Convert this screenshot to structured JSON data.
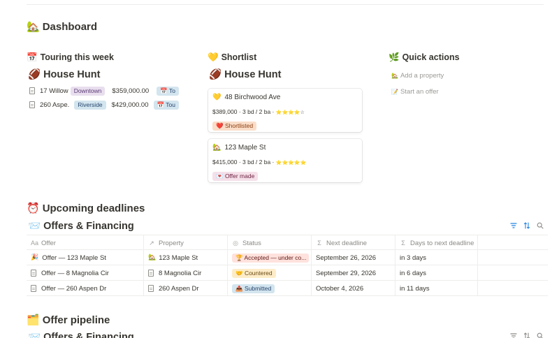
{
  "page": {
    "title": "Dashboard",
    "title_icon": "🏡"
  },
  "touring": {
    "heading": "Touring this week",
    "heading_icon": "📅",
    "db_title": "House Hunt",
    "db_icon": "🏈",
    "rows": [
      {
        "name": "17 Willow ...",
        "neighborhood": "Downtown",
        "price": "$359,000.00",
        "date_tag": "📅 To"
      },
      {
        "name": "260 Aspe...",
        "neighborhood": "Riverside",
        "price": "$429,000.00",
        "date_tag": "📅 Tou"
      }
    ]
  },
  "shortlist": {
    "heading": "Shortlist",
    "heading_icon": "💛",
    "db_title": "House Hunt",
    "db_icon": "🏈",
    "cards": [
      {
        "icon": "💛",
        "title": "48 Birchwood Ave",
        "meta": "$389,000 · 3 bd / 2 ba · ",
        "stars": "⭐⭐⭐⭐☆",
        "status": "❤️ Shortlisted"
      },
      {
        "icon": "🏡",
        "title": "123 Maple St",
        "meta": "$415,000 · 3 bd / 2 ba · ",
        "stars": "⭐⭐⭐⭐⭐",
        "status": "💌 Offer made"
      }
    ]
  },
  "quick_actions": {
    "heading": "Quick actions",
    "heading_icon": "🌿",
    "items": [
      {
        "icon": "🏡",
        "label": "Add a property"
      },
      {
        "icon": "📝",
        "label": "Start an offer"
      }
    ]
  },
  "deadlines": {
    "heading": "Upcoming deadlines",
    "heading_icon": "⏰",
    "db_title": "Offers & Financing",
    "db_icon": "📨",
    "columns": [
      "Offer",
      "Property",
      "Status",
      "Next deadline",
      "Days to next deadline"
    ],
    "column_icons": [
      "Aa",
      "↗",
      "◎",
      "Σ",
      "Σ"
    ],
    "rows": [
      {
        "offer_icon": "🎉",
        "offer": "Offer — 123 Maple St",
        "property_icon": "🏡",
        "property": "123 Maple St",
        "status": "🏆 Accepted — under co...",
        "deadline": "September 26, 2026",
        "days": "in 3 days"
      },
      {
        "offer_icon": "doc",
        "offer": "Offer — 8 Magnolia Cir",
        "property_icon": "doc",
        "property": "8 Magnolia Cir",
        "status": "🤝 Countered",
        "deadline": "September 29, 2026",
        "days": "in 6 days"
      },
      {
        "offer_icon": "doc",
        "offer": "Offer — 260 Aspen Dr",
        "property_icon": "doc",
        "property": "260 Aspen Dr",
        "status": "📤 Submitted",
        "deadline": "October 4, 2026",
        "days": "in 11 days"
      }
    ]
  },
  "pipeline": {
    "heading": "Offer pipeline",
    "heading_icon": "🗂️",
    "db_title": "Offers & Financing",
    "db_icon": "📨"
  },
  "icons": {
    "filter": "filter-icon",
    "sort": "sort-icon",
    "search": "search-icon"
  }
}
